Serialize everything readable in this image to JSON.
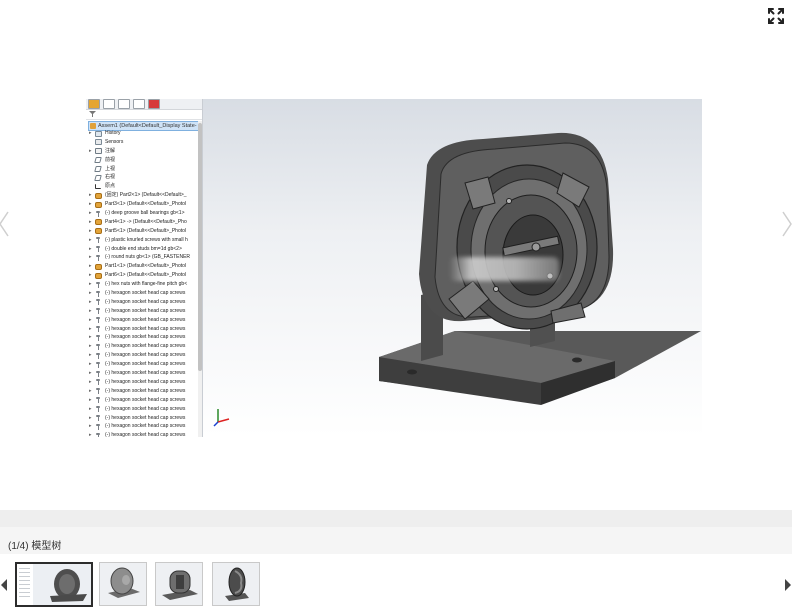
{
  "toolbar": {
    "fullscreen_icon": "fullscreen-icon"
  },
  "tree": {
    "root_label": "Assem1 (Default<Default_Display State-",
    "items": [
      {
        "label": "History",
        "icon": "history-icon",
        "expand": "▸"
      },
      {
        "label": "Sensors",
        "icon": "sensors-icon",
        "expand": ""
      },
      {
        "label": "注解",
        "icon": "annotations-icon",
        "expand": "▸"
      },
      {
        "label": "前视",
        "icon": "plane-icon",
        "expand": ""
      },
      {
        "label": "上视",
        "icon": "plane-icon",
        "expand": ""
      },
      {
        "label": "右视",
        "icon": "plane-icon",
        "expand": ""
      },
      {
        "label": "原点",
        "icon": "origin-icon",
        "expand": ""
      },
      {
        "label": "(固定) Part2<1> (Default<<Default>_",
        "icon": "part-icon",
        "expand": "▸"
      },
      {
        "label": "Part3<1> (Default<<Default>_Photol",
        "icon": "part-icon",
        "expand": "▸"
      },
      {
        "label": "(-) deep groove ball bearings gb<1>",
        "icon": "screw-icon",
        "expand": "▸"
      },
      {
        "label": "Part4<1> -> (Default<<Default>_Pho",
        "icon": "part-icon",
        "expand": "▸"
      },
      {
        "label": "Part5<1> (Default<<Default>_Photol",
        "icon": "part-icon",
        "expand": "▸"
      },
      {
        "label": "(-) plastic knurled screws with small h",
        "icon": "screw-icon",
        "expand": "▸"
      },
      {
        "label": "(-) double end studs bm=1d gb<2>",
        "icon": "screw-icon",
        "expand": "▸"
      },
      {
        "label": "(-) round nuts gb<1> (GB_FASTENER",
        "icon": "screw-icon",
        "expand": "▸"
      },
      {
        "label": "Part1<1> (Default<<Default>_Photol",
        "icon": "part-icon",
        "expand": "▸"
      },
      {
        "label": "Part6<1> (Default<<Default>_Photol",
        "icon": "part-icon",
        "expand": "▸"
      },
      {
        "label": "(-) hex nuts with flange-fine pitch gb<",
        "icon": "screw-icon",
        "expand": "▸"
      },
      {
        "label": "(-) hexagon socket head cap screws",
        "icon": "screw-icon",
        "expand": "▸"
      },
      {
        "label": "(-) hexagon socket head cap screws",
        "icon": "screw-icon",
        "expand": "▸"
      },
      {
        "label": "(-) hexagon socket head cap screws",
        "icon": "screw-icon",
        "expand": "▸"
      },
      {
        "label": "(-) hexagon socket head cap screws",
        "icon": "screw-icon",
        "expand": "▸"
      },
      {
        "label": "(-) hexagon socket head cap screws",
        "icon": "screw-icon",
        "expand": "▸"
      },
      {
        "label": "(-) hexagon socket head cap screws",
        "icon": "screw-icon",
        "expand": "▸"
      },
      {
        "label": "(-) hexagon socket head cap screws",
        "icon": "screw-icon",
        "expand": "▸"
      },
      {
        "label": "(-) hexagon socket head cap screws",
        "icon": "screw-icon",
        "expand": "▸"
      },
      {
        "label": "(-) hexagon socket head cap screws",
        "icon": "screw-icon",
        "expand": "▸"
      },
      {
        "label": "(-) hexagon socket head cap screws",
        "icon": "screw-icon",
        "expand": "▸"
      },
      {
        "label": "(-) hexagon socket head cap screws",
        "icon": "screw-icon",
        "expand": "▸"
      },
      {
        "label": "(-) hexagon socket head cap screws",
        "icon": "screw-icon",
        "expand": "▸"
      },
      {
        "label": "(-) hexagon socket head cap screws",
        "icon": "screw-icon",
        "expand": "▸"
      },
      {
        "label": "(-) hexagon socket head cap screws",
        "icon": "screw-icon",
        "expand": "▸"
      },
      {
        "label": "(-) hexagon socket head cap screws",
        "icon": "screw-icon",
        "expand": "▸"
      },
      {
        "label": "(-) hexagon socket head cap screws",
        "icon": "screw-icon",
        "expand": "▸"
      },
      {
        "label": "(-) hexagon socket head cap screws",
        "icon": "screw-icon",
        "expand": "▸"
      }
    ]
  },
  "gallery": {
    "caption": "(1/4) 模型树",
    "current": 1,
    "total": 4
  }
}
